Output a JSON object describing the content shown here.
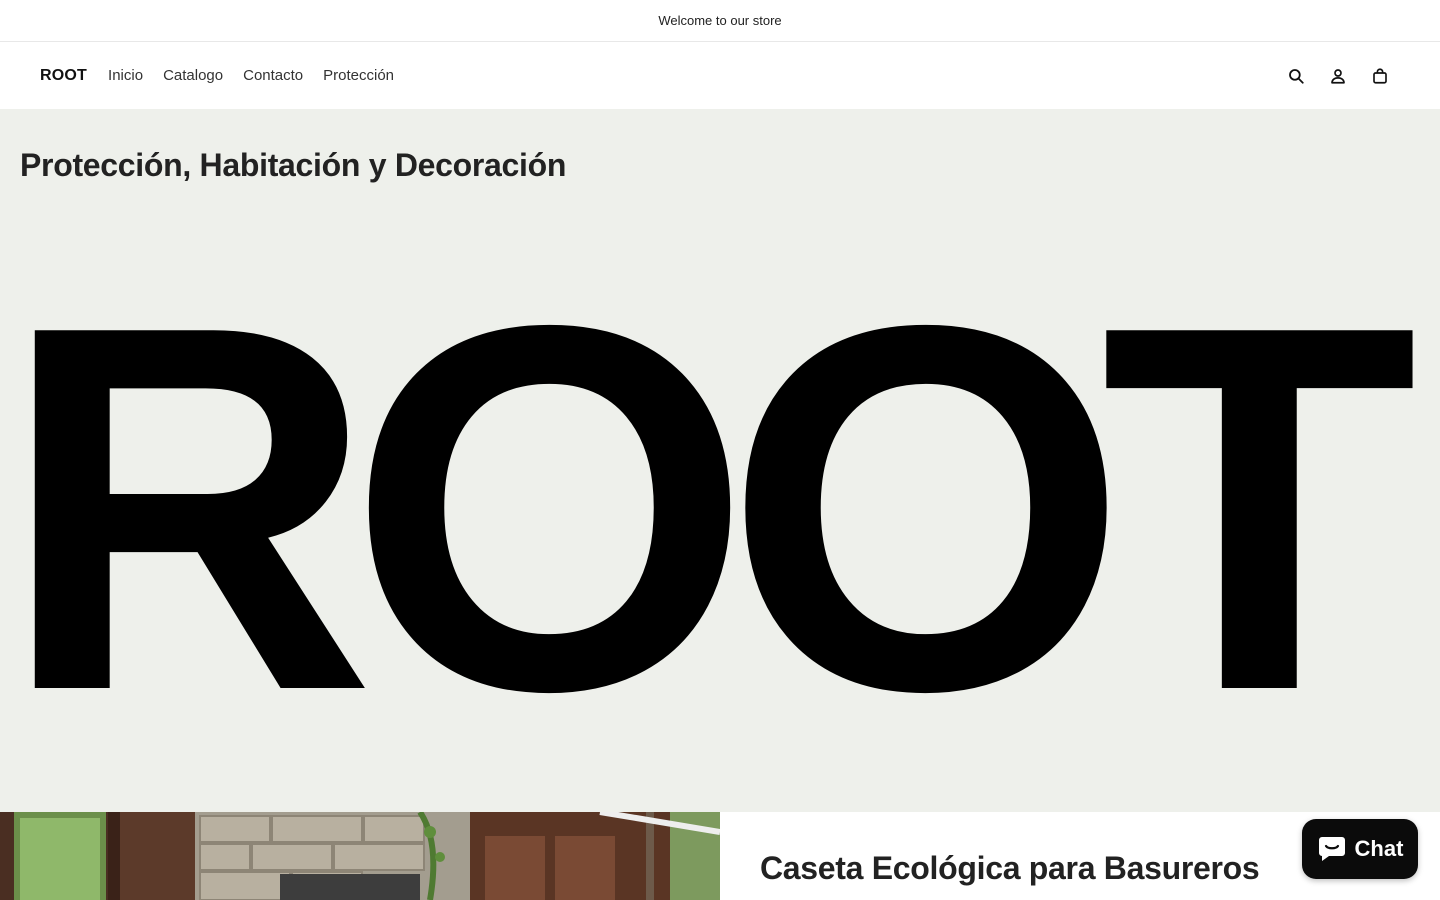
{
  "announcement": {
    "text": "Welcome to our store"
  },
  "header": {
    "logo": "ROOT",
    "nav": [
      {
        "label": "Inicio"
      },
      {
        "label": "Catalogo"
      },
      {
        "label": "Contacto"
      },
      {
        "label": "Protección"
      }
    ],
    "icons": [
      "search-icon",
      "account-icon",
      "cart-icon"
    ]
  },
  "hero": {
    "title": "Protección, Habitación y Decoración",
    "brand": "ROOT",
    "background": "#eef0eb"
  },
  "feature": {
    "title": "Caseta Ecológica para Basureros"
  },
  "chat": {
    "label": "Chat",
    "background": "#0b0b0b"
  }
}
